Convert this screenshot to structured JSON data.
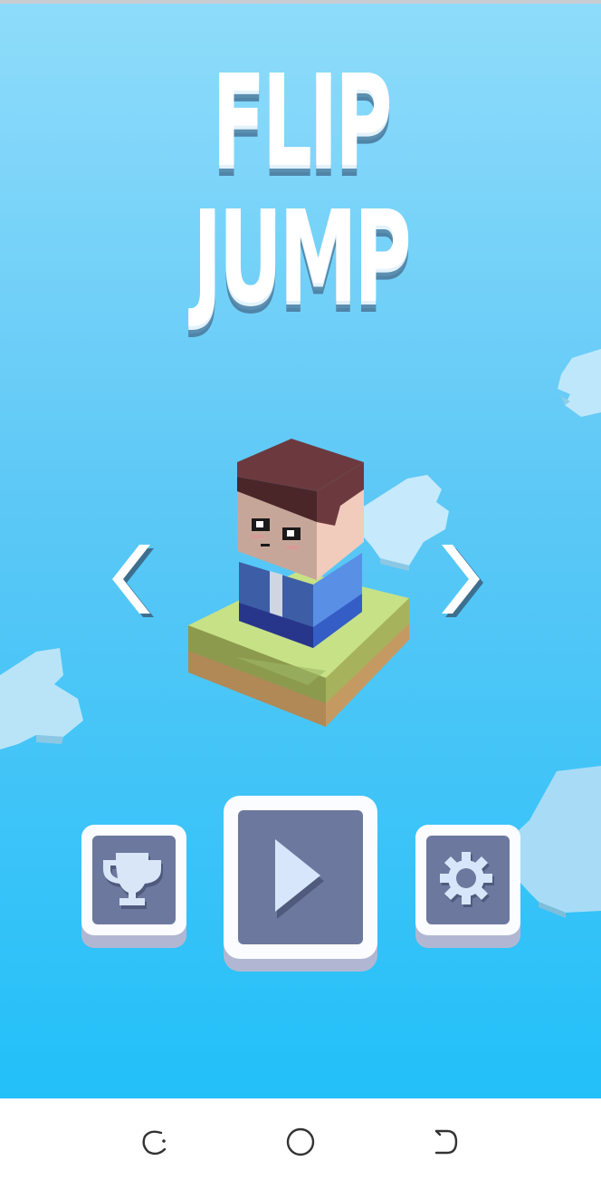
{
  "game": {
    "title_line_1": "FLIP",
    "title_line_2": "JUMP"
  },
  "character_select": {
    "prev_icon": "chevron-left-icon",
    "next_icon": "chevron-right-icon"
  },
  "menu": {
    "leaderboard_icon": "trophy-icon",
    "play_icon": "play-icon",
    "settings_icon": "gear-icon"
  },
  "system_nav": {
    "recents_icon": "recents-icon",
    "home_icon": "home-icon",
    "back_icon": "back-icon"
  },
  "colors": {
    "sky_top": "#8fdcfb",
    "sky_bottom": "#22c0f9",
    "button_face": "#6c789e",
    "button_frame": "#fbfcff"
  }
}
